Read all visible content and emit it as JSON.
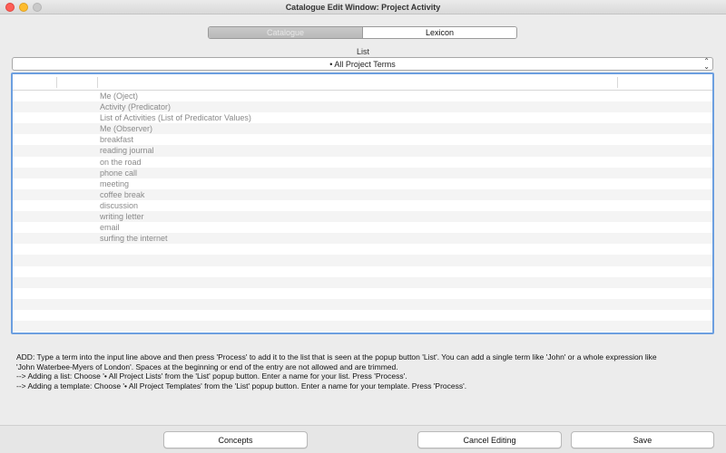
{
  "window": {
    "title": "Catalogue Edit Window: Project Activity"
  },
  "segments": [
    {
      "label": "Catalogue",
      "state": "inactive"
    },
    {
      "label": "Lexicon",
      "state": "active"
    }
  ],
  "list": {
    "label": "List",
    "selected": "• All Project Terms"
  },
  "table": {
    "columns": [
      "",
      "",
      "",
      ""
    ],
    "rows": [
      "Me (Oject)",
      "Activity (Predicator)",
      "List of Activities (List of Predicator Values)",
      "Me (Observer)",
      "breakfast",
      "reading journal",
      "on the road",
      "phone call",
      "meeting",
      "coffee break",
      "discussion",
      "writing letter",
      "email",
      "surfing the internet"
    ]
  },
  "help": {
    "line1": "ADD:  Type a term into the input line above and then press 'Process' to add it to the list that is seen at the popup button 'List'. You can add a single term like 'John' or a whole expression like",
    "line2": "'John Waterbee-Myers of London'. Spaces at the beginning or end of the entry are not allowed and are trimmed.",
    "line3": "--> Adding a list:  Choose '• All Project Lists' from the 'List' popup button. Enter a name for your list. Press 'Process'.",
    "line4": "--> Adding a template:  Choose '• All Project Templates' from the 'List' popup button. Enter a name for your template. Press 'Process'."
  },
  "buttons": {
    "concepts": "Concepts",
    "cancel": "Cancel Editing",
    "save": "Save"
  }
}
